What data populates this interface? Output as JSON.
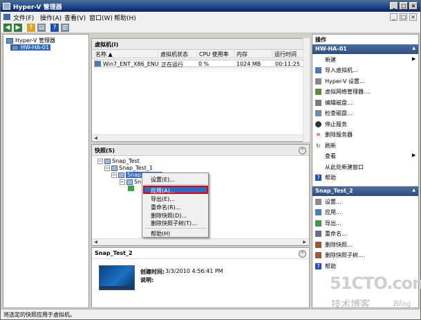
{
  "app": {
    "title": "Hyper-V 管理器"
  },
  "menu": {
    "items": [
      "文件(F)",
      "操作(A)",
      "查看(V)",
      "窗口(W)",
      "帮助(H)"
    ]
  },
  "tree": {
    "root": "Hyper-V 管理器",
    "server": "HW-HA-01"
  },
  "vms": {
    "title": "虚拟机(I)",
    "columns": [
      "名称 ▲",
      "虚拟机状态",
      "CPU 使用率",
      "内存",
      "运行时间"
    ],
    "rows": [
      {
        "name": "Win7_ENT_X86_ENU",
        "state": "正在运行",
        "cpu": "0 %",
        "memory": "1024 MB",
        "uptime": "00:11:25"
      }
    ]
  },
  "snapshots": {
    "title": "快照(S)",
    "items": [
      "Snap_Test",
      "Snap_Test_1",
      "Snap_Test_2",
      "Sn"
    ]
  },
  "context_menu": {
    "items": [
      "设置(E)...",
      "应用(A)...",
      "导出(E)...",
      "重命名(R)...",
      "删除快照(D)...",
      "删除快照子树(T)...",
      "帮助(H)"
    ]
  },
  "details": {
    "title": "Snap_Test_2",
    "created_label": "创建时间:",
    "created_value": "3/3/2010 4:56:41 PM",
    "notes_label": "说明:"
  },
  "actions": {
    "title": "操作",
    "server_section": "HW-HA-01",
    "server_items": [
      "新建",
      "导入虚拟机...",
      "Hyper-V 设置...",
      "虚拟网络管理器...",
      "编辑磁盘...",
      "检查磁盘...",
      "停止服务",
      "删除服务器",
      "刷新",
      "查看",
      "从此处新建窗口",
      "帮助"
    ],
    "snapshot_section": "Snap_Test_2",
    "snapshot_items": [
      "设置...",
      "应用...",
      "导出...",
      "重命名...",
      "删除快照...",
      "删除快照子树...",
      "帮助"
    ]
  },
  "status": {
    "text": "将选定的快照应用于虚拟机。"
  },
  "watermark": {
    "site": "51CTO.com",
    "tagline": "技术博客",
    "blog": "Blog"
  },
  "colors": {
    "title_bar": "#0a246a",
    "selection": "#316ac5",
    "highlight_border": "#e00000",
    "action_header": "#2c4e7e"
  }
}
